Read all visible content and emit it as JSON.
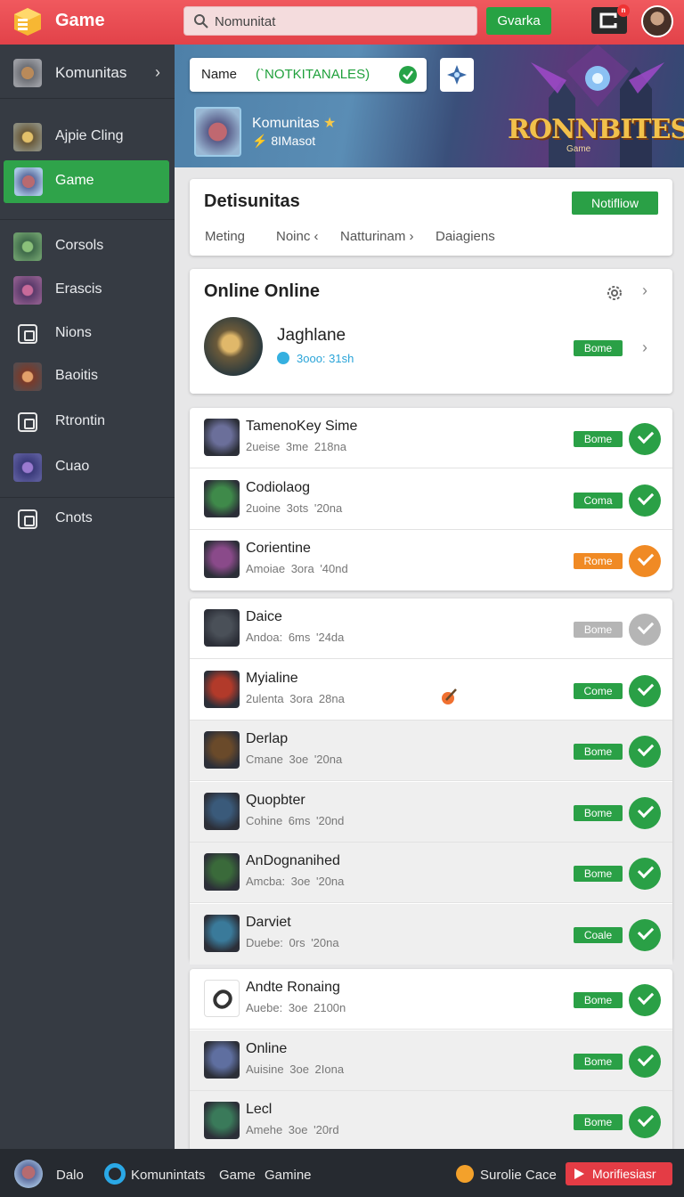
{
  "topbar": {
    "brand": "Game",
    "search_value": "Nomunitat",
    "primary_button": "Gvarka",
    "notification_count": "n"
  },
  "sidebar": {
    "items": [
      {
        "label": "Komunitas",
        "icon": "game-avatar-icon"
      },
      {
        "label": "Ajpie Cling",
        "icon": "game-avatar-icon"
      },
      {
        "label": "Game",
        "icon": "game-avatar-icon",
        "active": true
      },
      {
        "label": "Corsols",
        "icon": "game-avatar-icon"
      },
      {
        "label": "Erascis",
        "icon": "game-avatar-icon"
      },
      {
        "label": "Nions",
        "icon": "square-outline-icon"
      },
      {
        "label": "Baoitis",
        "icon": "game-avatar-icon"
      },
      {
        "label": "Rtrontin",
        "icon": "square-outline-icon"
      },
      {
        "label": "Cuao",
        "icon": "game-avatar-icon"
      },
      {
        "label": "Cnots",
        "icon": "square-outline-icon"
      }
    ]
  },
  "banner": {
    "name_label": "Name",
    "name_value": "(`NOTKITANALES)",
    "title": "Komunitas",
    "title_mark": "★",
    "subtitle_mark": "⚡",
    "subtitle": "8IMasot",
    "logo_text": "RONNBITES",
    "logo_sub": "Game"
  },
  "details": {
    "title": "Detisunitas",
    "button": "Notifliow",
    "tabs": [
      "Meting",
      "Noinc ‹",
      "Natturinam ›",
      "Daiagiens"
    ]
  },
  "online": {
    "title": "Online Online",
    "user_name": "Jaghlane",
    "user_status": "3ooo: 31sh",
    "button": "Bome"
  },
  "groups": [
    [
      {
        "title": "TamenoKey Sime",
        "sub": "2ueise 3me 218na",
        "badge": "Bome",
        "status": "green",
        "thumb": "#6b6f9a"
      },
      {
        "title": "Codiolaog",
        "sub": "2uoine 3ots '20na",
        "badge": "Coma",
        "status": "green",
        "thumb": "#3f8a4a"
      },
      {
        "title": "Corientine",
        "sub": "Amoiae 3ora '40nd",
        "badge": "Rome",
        "status": "orange",
        "thumb": "#8a4a8a"
      }
    ],
    [
      {
        "title": "Daice",
        "sub": "Andoa: 6ms '24da",
        "badge": "Bome",
        "status": "gray",
        "thumb": "#4a5058"
      },
      {
        "title": "Myialine",
        "sub": "2ulenta 3ora 28na",
        "badge": "Come",
        "status": "green",
        "thumb": "#b23a2a"
      },
      {
        "title": "Derlap",
        "sub": "Cmane 3oe '20na",
        "badge": "Bome",
        "status": "green",
        "thumb": "#6a4a2a"
      },
      {
        "title": "Quopbter",
        "sub": "Cohine 6ms '20nd",
        "badge": "Bome",
        "status": "green",
        "thumb": "#3a5a7a"
      },
      {
        "title": "AnDognanihed",
        "sub": "Amcba: 3oe '20na",
        "badge": "Bome",
        "status": "green",
        "thumb": "#3a6a3a"
      },
      {
        "title": "Darviet",
        "sub": "Duebe: 0rs '20na",
        "badge": "Coale",
        "status": "green",
        "thumb": "#3a7a9a"
      }
    ],
    [
      {
        "title": "Andte Ronaing",
        "sub": "Auebe: 3oe 2100n",
        "badge": "Bome",
        "status": "green",
        "thumb": "#ffffff"
      },
      {
        "title": "Online",
        "sub": "Auisine 3oe 2Iona",
        "badge": "Bome",
        "status": "green",
        "thumb": "#5f6fa0"
      },
      {
        "title": "Lecl",
        "sub": "Amehe 3oe '20rd",
        "badge": "Bome",
        "status": "green",
        "thumb": "#3a7a5a"
      }
    ]
  ],
  "bottombar": {
    "label1": "Dalo",
    "label2": "Komunintats",
    "label3": "Game",
    "label4": "Gamine",
    "label5": "Surolie Cace",
    "notify_button": "Morifiesiasr"
  },
  "colors": {
    "accent_red": "#e24249",
    "accent_green": "#2aa046",
    "status_orange": "#f08a24",
    "status_gray": "#b5b5b5",
    "sidebar_bg": "#363b43"
  }
}
